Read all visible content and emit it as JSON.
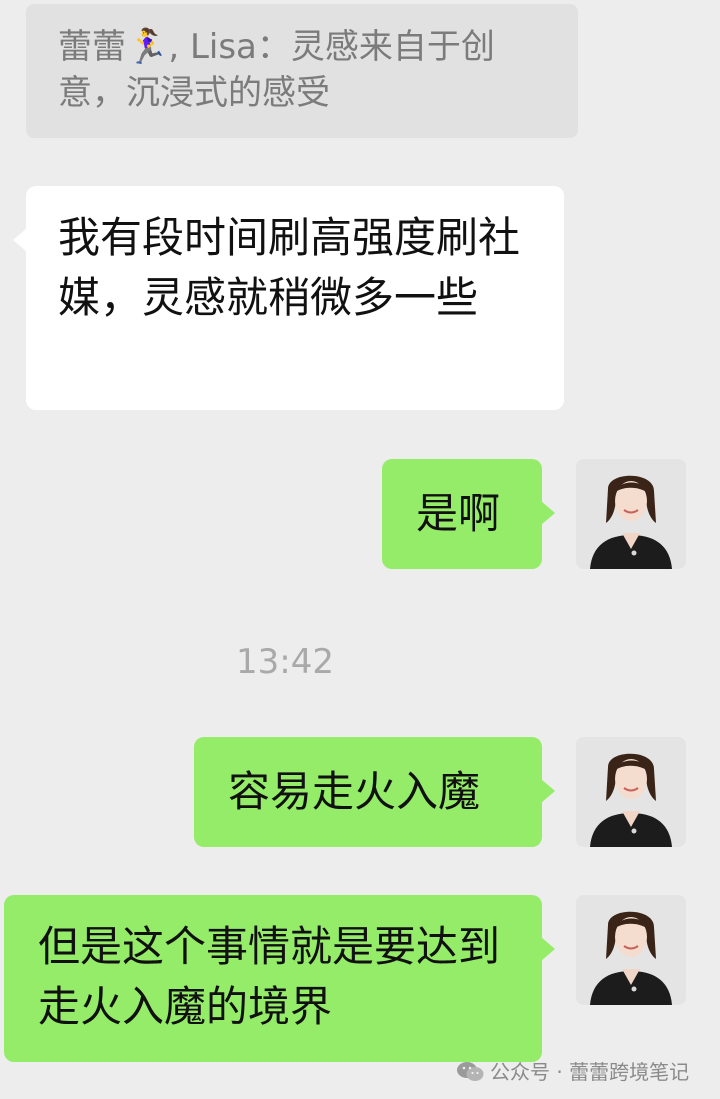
{
  "quote": {
    "text": "蕾蕾🏃‍♀️, Lisa：灵感来自于创意，沉浸式的感受"
  },
  "messages": [
    {
      "text": "我有段时间刷高强度刷社媒，灵感就稍微多一些"
    },
    {
      "text": "是啊"
    },
    {
      "text": "容易走火入魔"
    },
    {
      "text": "但是这个事情就是要达到走火入魔的境界"
    }
  ],
  "timestamp": "13:42",
  "watermark": {
    "text": "公众号 · 蕾蕾跨境笔记",
    "icon": "wechat-icon"
  },
  "colors": {
    "background": "#ededed",
    "quote_bg": "#e1e1e1",
    "incoming_bubble": "#ffffff",
    "outgoing_bubble": "#95ec69"
  }
}
